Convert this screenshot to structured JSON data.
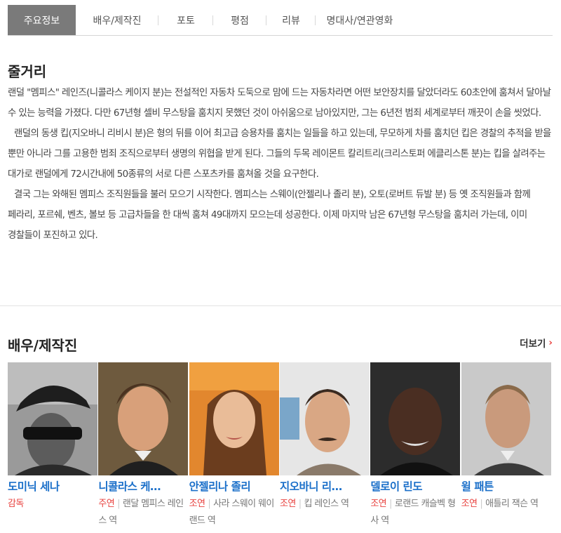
{
  "tabs": [
    {
      "label": "주요정보",
      "active": true
    },
    {
      "label": "배우/제작진"
    },
    {
      "label": "포토"
    },
    {
      "label": "평점"
    },
    {
      "label": "리뷰"
    },
    {
      "label": "명대사/연관영화"
    }
  ],
  "synopsis": {
    "title": "줄거리",
    "paragraphs": [
      "랜덜 \"멤피스\" 레인즈(니콜라스 케이지 분)는 전설적인 자동차 도둑으로 맘에 드는 자동차라면 어떤 보안장치를 달았더라도 60초안에 훔쳐서 달아날 수 있는 능력을 가졌다. 다만 67년형 셀비 무스탕을 훔치지 못했던 것이 아쉬움으로 남아있지만, 그는 6년전 범죄 세계로부터 깨끗이 손을 씻었다.",
      "랜덜의 동생 킵(지오바니 리비시 분)은 형의 뒤를 이어 최고급 승용차를 훔치는 일들을 하고 있는데, 무모하게 차를 훔치던 킵은 경찰의 추적을 받을 뿐만 아니라 그를 고용한 범죄 조직으로부터 생명의 위협을 받게 된다. 그들의 두목 레이몬트 칼리트리(크리스토퍼 에클리스톤 분)는 킵을 살려주는 대가로 랜덜에게 72시간내에 50종류의 서로 다른 스포츠카를 훔쳐올 것을 요구한다.",
      "결국 그는 와해된 멤피스 조직원들을 불러 모으기 시작한다. 멤피스는 스웨이(안젤리나 졸리 분), 오토(로버트 듀발 분) 등 옛 조직원들과 함께 페라리, 포르쉐, 벤츠, 볼보 등 고급차들을 한 대씩 훔쳐 49대까지 모으는데 성공한다. 이제 마지막 남은 67년형 무스탕을 훔치러 가는데, 이미 경찰들이 포진하고 있다."
    ]
  },
  "cast_section": {
    "title": "배우/제작진",
    "more_label": "더보기",
    "more_icon": "chevron-right-icon",
    "members": [
      {
        "name": "도미닉 세나",
        "role": "감독",
        "character": ""
      },
      {
        "name": "니콜라스 케…",
        "role": "주연",
        "character": "랜달 멤피스 레인스 역"
      },
      {
        "name": "안젤리나 졸리",
        "role": "조연",
        "character": "사라 스웨이 웨이랜드 역"
      },
      {
        "name": "지오바니 리…",
        "role": "조연",
        "character": "킵 레인스 역"
      },
      {
        "name": "델로이 린도",
        "role": "조연",
        "character": "로랜드 캐슬벡 형사 역"
      },
      {
        "name": "윌 패튼",
        "role": "조연",
        "character": "애틀리 잭슨 역"
      }
    ]
  },
  "colors": {
    "accent_red": "#e8423f",
    "link_blue": "#1a6fc9",
    "active_tab_bg": "#7a7a7a"
  }
}
